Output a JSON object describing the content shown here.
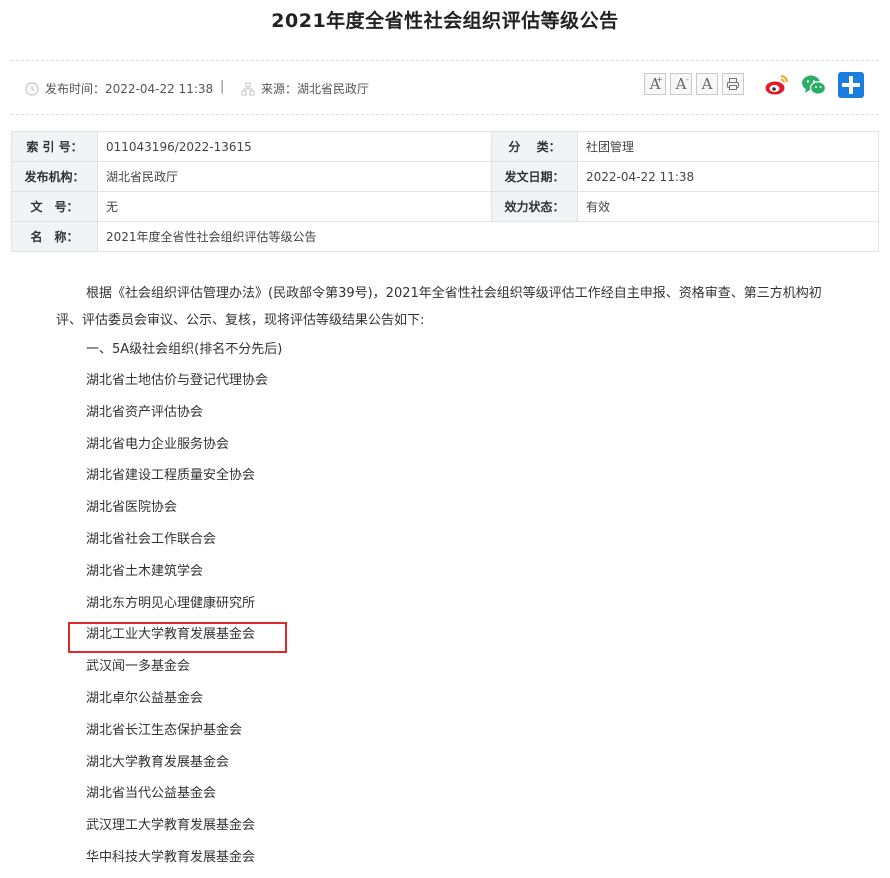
{
  "article": {
    "title": "2021年度全省性社会组织评估等级公告",
    "publish_time": "发布时间：2022-04-22 11:38",
    "separator": "|",
    "source": "来源：湖北省民政厅"
  },
  "toolbar": {
    "font_large": "A",
    "font_large_mark": "+",
    "font_small": "A",
    "font_small_mark": "-",
    "font_reset": "A",
    "icons": [
      "print-icon",
      "weibo-icon",
      "wechat-icon",
      "share-plus-icon"
    ],
    "colors": {
      "weibo": "#e6162d",
      "weibo_accent": "#f5a623",
      "wechat": "#2aae67",
      "plus": "#1a7ee0"
    }
  },
  "info": {
    "index_label": "索 引 号：",
    "index_value": "011043196/2022-13615",
    "category_label": "分　 类：",
    "category_value": "社团管理",
    "publisher_label": "发布机构：",
    "publisher_value": "湖北省民政厅",
    "date_label": "发文日期：",
    "date_value": "2022-04-22 11:38",
    "docno_label": "文　号：",
    "docno_value": "无",
    "status_label": "效力状态：",
    "status_value": "有效",
    "name_label": "名　称：",
    "name_value": "2021年度全省性社会组织评估等级公告"
  },
  "body": {
    "intro": "根据《社会组织评估管理办法》(民政部令第39号)，2021年全省性社会组织等级评估工作经自主申报、资格审查、第三方机构初评、评估委员会审议、公示、复核，现将评估等级结果公告如下:",
    "section_title": "一、5A级社会组织(排名不分先后)",
    "organizations": [
      "湖北省土地估价与登记代理协会",
      "湖北省资产评估协会",
      "湖北省电力企业服务协会",
      "湖北省建设工程质量安全协会",
      "湖北省医院协会",
      "湖北省社会工作联合会",
      "湖北省土木建筑学会",
      "湖北东方明见心理健康研究所",
      "湖北工业大学教育发展基金会",
      "武汉闻一多基金会",
      "湖北卓尔公益基金会",
      "湖北省长江生态保护基金会",
      "湖北大学教育发展基金会",
      "湖北省当代公益基金会",
      "武汉理工大学教育发展基金会",
      "华中科技大学教育发展基金会"
    ],
    "highlight_color": "#e02a2a"
  }
}
